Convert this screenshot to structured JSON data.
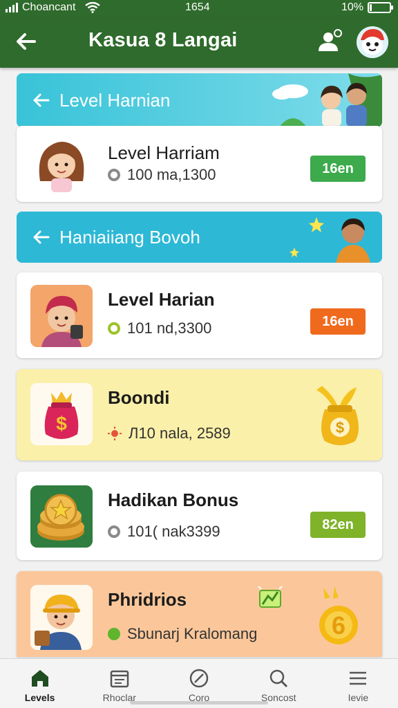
{
  "status_bar": {
    "carrier": "Choancant",
    "time": "1654",
    "battery": "10%",
    "battery_level": 0.1
  },
  "header": {
    "title": "Kasua 8 Langai",
    "back_icon": "arrow-left-icon",
    "profile_icon": "add-user-icon",
    "avatar_icon": "avatar-icon"
  },
  "sections": [
    {
      "title": "Level Harnian",
      "color": "#3fc7db"
    },
    {
      "title": "Haniaiiang Bovoh",
      "color": "#2db8d6"
    }
  ],
  "cards": [
    {
      "title": "Level Harriam",
      "meta": "100 ma,1300",
      "badge": "16en",
      "badge_color": "#3daa4b",
      "dot_color": "#8a8a8a"
    },
    {
      "title": "Level Harian",
      "meta": "101 nd,3300",
      "badge": "16en",
      "badge_color": "#f06a1e",
      "dot_color": "#9dc22b"
    },
    {
      "title": "Boondi",
      "meta": "Л10 nala, 2589",
      "badge": "",
      "badge_color": "",
      "dot_color": "#e4543b"
    },
    {
      "title": "Hadikan Bonus",
      "meta": "101( nak3399",
      "badge": "82en",
      "badge_color": "#7fb32a",
      "dot_color": "#8a8a8a"
    },
    {
      "title": "Phridrios",
      "meta": "Sbunarj Kralomang",
      "badge": "",
      "badge_color": "",
      "dot_color": "#5fb52d"
    }
  ],
  "nav": [
    {
      "label": "Levels",
      "icon": "home-icon",
      "active": true
    },
    {
      "label": "Rhoclar",
      "icon": "calendar-icon",
      "active": false
    },
    {
      "label": "Coro",
      "icon": "compass-icon",
      "active": false
    },
    {
      "label": "Soncost",
      "icon": "search-icon",
      "active": false
    },
    {
      "label": "Ievie",
      "icon": "menu-icon",
      "active": false
    }
  ]
}
